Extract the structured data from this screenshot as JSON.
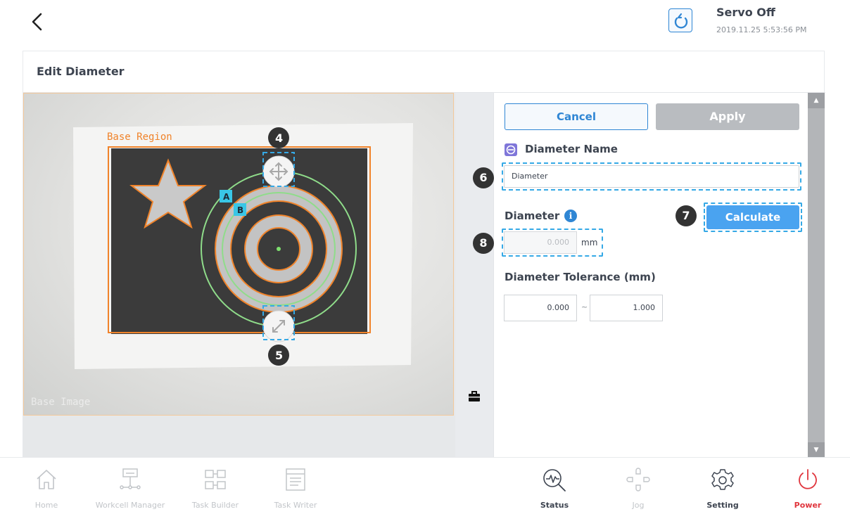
{
  "header": {
    "servo_status": "Servo Off",
    "datetime": "2019.11.25 5:53:56 PM"
  },
  "panel": {
    "title": "Edit Diameter"
  },
  "camera": {
    "region_label": "Base Region",
    "region_label_color": "#f0832a",
    "circle_color": "#8fdc8a",
    "marker_a": "A",
    "marker_b": "B",
    "watermark": "Base Image"
  },
  "form": {
    "cancel_label": "Cancel",
    "apply_label": "Apply",
    "name_label": "Diameter Name",
    "name_value": "Diameter",
    "diameter_label": "Diameter",
    "info_glyph": "i",
    "diameter_value": "0.000",
    "diameter_unit": "mm",
    "calculate_label": "Calculate",
    "tolerance_label": "Diameter Tolerance (mm)",
    "tolerance_min": "0.000",
    "tolerance_separator": "~",
    "tolerance_max": "1.000"
  },
  "annotations": {
    "n4": "4",
    "n5": "5",
    "n6": "6",
    "n7": "7",
    "n8": "8"
  },
  "nav": {
    "items": [
      {
        "label": "Home",
        "icon": "home-icon"
      },
      {
        "label": "Workcell Manager",
        "icon": "workcell-icon"
      },
      {
        "label": "Task Builder",
        "icon": "task-builder-icon"
      },
      {
        "label": "Task Writer",
        "icon": "task-writer-icon"
      },
      {
        "label": "Status",
        "icon": "status-icon"
      },
      {
        "label": "Jog",
        "icon": "jog-icon"
      },
      {
        "label": "Setting",
        "icon": "gear-icon"
      },
      {
        "label": "Power",
        "icon": "power-icon"
      }
    ]
  },
  "colors": {
    "accent": "#2f86d4",
    "calculate": "#4aa3f0",
    "apply_disabled": "#b9bcc0",
    "power": "#e0353d",
    "annotation": "#35a9e6"
  }
}
